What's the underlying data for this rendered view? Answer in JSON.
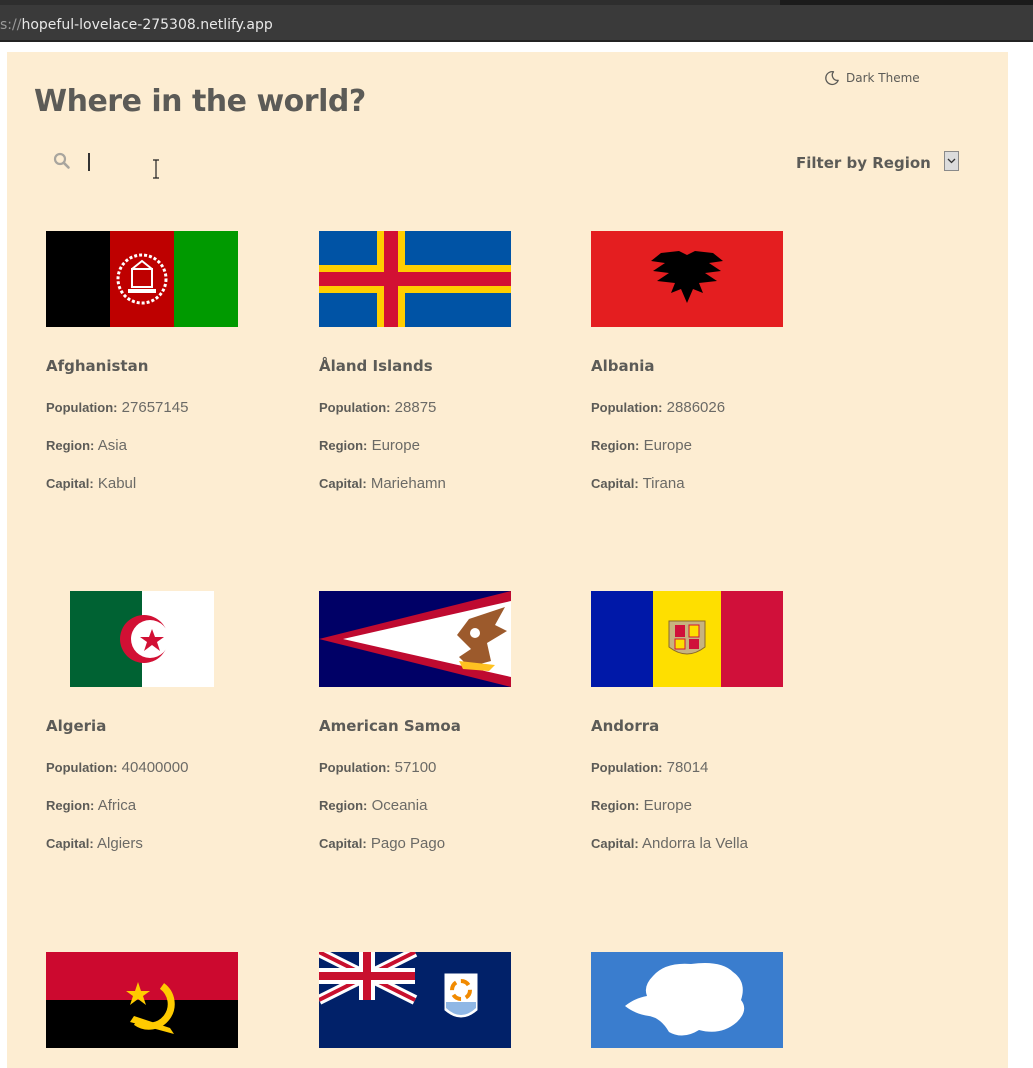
{
  "browser": {
    "url_protocol": "s://",
    "url_host": "hopeful-lovelace-275308.netlify.app"
  },
  "header": {
    "title": "Where in the world?",
    "theme_toggle": {
      "icon": "moon-icon",
      "label": "Dark Theme"
    }
  },
  "search": {
    "icon": "search-icon",
    "value": "",
    "placeholder": ""
  },
  "filter": {
    "label": "Filter by Region",
    "icon": "chevron-down-icon"
  },
  "labels": {
    "population": "Population:",
    "region": "Region:",
    "capital": "Capital:"
  },
  "countries": [
    {
      "name": "Afghanistan",
      "population": "27657145",
      "region": "Asia",
      "capital": "Kabul",
      "flag": "flag-afghanistan"
    },
    {
      "name": "Åland Islands",
      "population": "28875",
      "region": "Europe",
      "capital": "Mariehamn",
      "flag": "flag-aland-islands"
    },
    {
      "name": "Albania",
      "population": "2886026",
      "region": "Europe",
      "capital": "Tirana",
      "flag": "flag-albania"
    },
    {
      "name": "Algeria",
      "population": "40400000",
      "region": "Africa",
      "capital": "Algiers",
      "flag": "flag-algeria"
    },
    {
      "name": "American Samoa",
      "population": "57100",
      "region": "Oceania",
      "capital": "Pago Pago",
      "flag": "flag-american-samoa"
    },
    {
      "name": "Andorra",
      "population": "78014",
      "region": "Europe",
      "capital": "Andorra la Vella",
      "flag": "flag-andorra"
    },
    {
      "flag": "flag-angola"
    },
    {
      "flag": "flag-anguilla"
    },
    {
      "flag": "flag-antarctica"
    }
  ],
  "colors": {
    "page_background": "#fdedd2",
    "text": "#5c5b57"
  }
}
